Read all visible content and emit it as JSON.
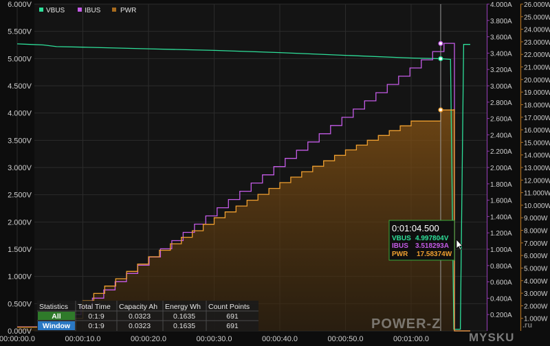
{
  "chart_data": {
    "type": "line",
    "series": [
      {
        "name": "VBUS",
        "color": "#2ee09a",
        "axis": "left",
        "unit": "V",
        "points": [
          [
            0,
            5.27
          ],
          [
            2,
            5.26
          ],
          [
            4,
            5.25
          ],
          [
            6,
            5.22
          ],
          [
            10,
            5.21
          ],
          [
            20,
            5.18
          ],
          [
            30,
            5.15
          ],
          [
            40,
            5.11
          ],
          [
            50,
            5.06
          ],
          [
            60,
            5.01
          ],
          [
            64.5,
            4.998
          ],
          [
            66,
            4.985
          ],
          [
            66.5,
            0.03
          ],
          [
            67.5,
            0.03
          ],
          [
            68,
            5.26
          ],
          [
            69,
            5.26
          ]
        ]
      },
      {
        "name": "IBUS",
        "color": "#c55be8",
        "axis": "right1",
        "unit": "A",
        "points": [
          [
            0,
            0.05
          ],
          [
            2,
            0.05
          ],
          [
            4,
            0.05
          ],
          [
            6,
            0.05
          ],
          [
            6.5,
            0.18
          ],
          [
            8,
            0.2
          ],
          [
            65,
            3.52
          ],
          [
            66.5,
            3.52
          ],
          [
            66.6,
            0.0
          ],
          [
            69,
            0.0
          ]
        ]
      },
      {
        "name": "PWR",
        "color": "#f0a030",
        "axis": "right2",
        "unit": "W",
        "points": [
          [
            0,
            0.3
          ],
          [
            6,
            0.3
          ],
          [
            6.5,
            1.0
          ],
          [
            10,
            2.4
          ],
          [
            20,
            5.9
          ],
          [
            30,
            9.0
          ],
          [
            40,
            11.8
          ],
          [
            50,
            14.4
          ],
          [
            60,
            16.7
          ],
          [
            64.5,
            17.58
          ],
          [
            66.5,
            17.6
          ],
          [
            66.6,
            0.0
          ],
          [
            69,
            0.0
          ]
        ]
      }
    ],
    "x_ticks": [
      "00:00:00.0",
      "00:00:10.0",
      "00:00:20.0",
      "00:00:30.0",
      "00:00:40.0",
      "00:00:50.0",
      "00:01:00.0"
    ],
    "x_tick_values": [
      0,
      10,
      20,
      30,
      40,
      50,
      60
    ],
    "xlim": [
      0,
      69.2
    ],
    "left_axis": {
      "ticks": [
        "0.000V",
        "0.500V",
        "1.000V",
        "1.500V",
        "2.000V",
        "2.500V",
        "3.000V",
        "3.500V",
        "4.000V",
        "4.500V",
        "5.000V",
        "5.500V",
        "6.000V"
      ],
      "lim": [
        0,
        6
      ]
    },
    "right_axis_1": {
      "ticks": [
        "0.200A",
        "0.400A",
        "0.600A",
        "0.800A",
        "1.000A",
        "1.200A",
        "1.400A",
        "1.600A",
        "1.800A",
        "2.000A",
        "2.200A",
        "2.400A",
        "2.600A",
        "2.800A",
        "3.000A",
        "3.200A",
        "3.400A",
        "3.600A",
        "3.800A",
        "4.000A"
      ],
      "lim": [
        0,
        4
      ]
    },
    "right_axis_2": {
      "ticks": [
        "1.000W",
        "2.000W",
        "3.000W",
        "4.000W",
        "5.000W",
        "6.000W",
        "7.000W",
        "8.000W",
        "9.000W",
        "10.000W",
        "11.000W",
        "12.000W",
        "13.000W",
        "14.000W",
        "15.000W",
        "16.000W",
        "17.000W",
        "18.000W",
        "19.000W",
        "20.000W",
        "21.000W",
        "22.000W",
        "23.000W",
        "24.000W",
        "25.000W",
        "26.000W"
      ],
      "lim": [
        0,
        26
      ]
    },
    "cursor": {
      "x": 64.5,
      "time": "0:01:04.500",
      "vbus": "4.997804V",
      "ibus": "3.518293A",
      "pwr": "17.58374W",
      "vbus_val": 4.997804,
      "ibus_val": 3.518293,
      "pwr_val": 17.58374
    },
    "grid": true,
    "legend_placement": "top-left"
  },
  "legend": [
    "VBUS",
    "IBUS",
    "PWR"
  ],
  "tooltip": {
    "time": "0:01:04.500",
    "rows": [
      {
        "label": "VBUS",
        "value": "4.997804V",
        "color": "#2ee09a"
      },
      {
        "label": "IBUS",
        "value": "3.518293A",
        "color": "#c55be8"
      },
      {
        "label": "PWR",
        "value": "17.58374W",
        "color": "#f0a030"
      }
    ]
  },
  "stats": {
    "headers": [
      "Statistics",
      "Total Time",
      "Capacity Ah",
      "Energy Wh",
      "Count Points"
    ],
    "rows": [
      {
        "label": "All",
        "label_color": "#2f7a2a",
        "cells": [
          "0:1:9",
          "0.0323",
          "0.1635",
          "691"
        ]
      },
      {
        "label": "Window",
        "label_color": "#2a78c4",
        "cells": [
          "0:1:9",
          "0.0323",
          "0.1635",
          "691"
        ]
      }
    ]
  },
  "watermark": {
    "power": "POWER-Z",
    "mysku": "MYSKU",
    "ru": ".ru"
  }
}
